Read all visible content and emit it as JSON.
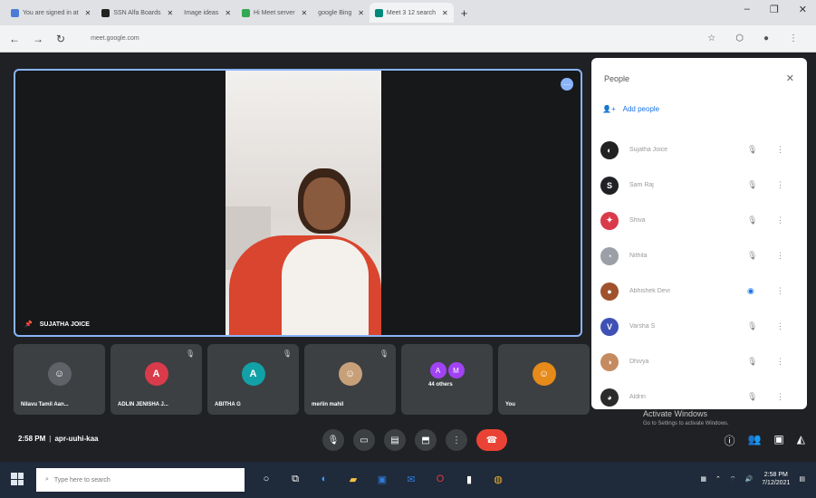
{
  "browser": {
    "tabs": [
      {
        "label": "You are signed in at"
      },
      {
        "label": "SSN Alfa Boards"
      },
      {
        "label": "Image ideas"
      },
      {
        "label": "Hi Meet server"
      },
      {
        "label": "google Bing"
      },
      {
        "label": "Meet 3 12 search"
      }
    ],
    "url": "meet.google.com"
  },
  "meet": {
    "main_tile_name": "SUJATHA JOICE",
    "thumbs": [
      {
        "name": "Nilavu Tamil Aan...",
        "avatar_letter": "",
        "avatar_color": "#5f6368"
      },
      {
        "name": "ADLIN JENISHA J...",
        "avatar_letter": "A",
        "avatar_color": "#d93b4a"
      },
      {
        "name": "ABITHA G",
        "avatar_letter": "A",
        "avatar_color": "#12a1a6"
      },
      {
        "name": "merlin mahil",
        "avatar_letter": "",
        "avatar_color": "#c7a07a"
      },
      {
        "name": "44 others",
        "avatar_letter": "",
        "avatar_color": "#a142f4",
        "letters": [
          "A",
          "M"
        ]
      },
      {
        "name": "You",
        "avatar_letter": "",
        "avatar_color": "#e68a1a"
      }
    ],
    "time": "2:58 PM",
    "meeting_code": "apr-uuhi-kaa",
    "activate": {
      "title": "Activate Windows",
      "subtitle": "Go to Settings to activate Windows."
    }
  },
  "people_panel": {
    "title": "People",
    "add_people": "Add people",
    "participants": [
      {
        "name": "Sujatha Joice",
        "avatar_letter": "",
        "color": "#222222"
      },
      {
        "name": "Sam Raj",
        "avatar_letter": "S",
        "color": "#202124"
      },
      {
        "name": "Shiva",
        "avatar_letter": "",
        "color": "#d93b4a"
      },
      {
        "name": "Nithila",
        "avatar_letter": "",
        "color": "#9aa0a6"
      },
      {
        "name": "Abhishek Devi",
        "avatar_letter": "",
        "color": "#a0522d"
      },
      {
        "name": "Varsha S",
        "avatar_letter": "V",
        "color": "#3f51b5"
      },
      {
        "name": "Dhivya",
        "avatar_letter": "",
        "color": "#c58b60"
      },
      {
        "name": "Aldrin",
        "avatar_letter": "",
        "color": "#2b2b2b"
      }
    ]
  },
  "taskbar": {
    "search_placeholder": "Type here to search",
    "clock_time": "2:58 PM",
    "clock_date": "7/12/2021"
  }
}
